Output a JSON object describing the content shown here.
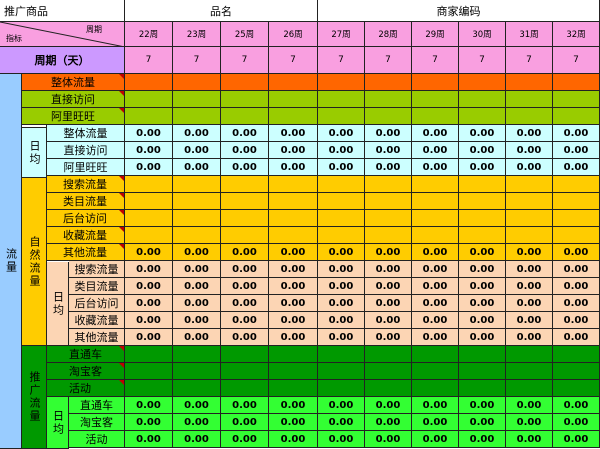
{
  "header": {
    "promo_goods": "推广商品",
    "product_name": "品名",
    "merchant_code": "商家编码",
    "diag_top": "周期",
    "diag_bottom": "指标",
    "period_days": "周期（天）"
  },
  "weeks": [
    "22周",
    "23周",
    "25周",
    "26周",
    "27周",
    "28周",
    "29周",
    "30周",
    "31周",
    "32周"
  ],
  "period_values": [
    "7",
    "7",
    "7",
    "7",
    "7",
    "7",
    "7",
    "7",
    "7",
    "7"
  ],
  "labels": {
    "traffic": "流量",
    "daily_avg": "日均",
    "natural_traffic": "自然流量",
    "promo_traffic": "推广流量",
    "overall": "整体流量",
    "direct": "直接访问",
    "wangwang": "阿里旺旺",
    "search": "搜索流量",
    "category": "类目流量",
    "backend": "后台访问",
    "favorites": "收藏流量",
    "other": "其他流量",
    "ztc": "直通车",
    "taobaoke": "淘宝客",
    "activity": "活动"
  },
  "rows": [
    {
      "label": "整体流量",
      "indent": 1,
      "bg": "#ff6600",
      "values": []
    },
    {
      "label": "直接访问",
      "indent": 1,
      "bg": "#99cc00",
      "values": []
    },
    {
      "label": "阿里旺旺",
      "indent": 1,
      "bg": "#99cc00",
      "values": []
    },
    {
      "label": "整体流量",
      "indent": 2,
      "bg": "#ccffff",
      "values": [
        "0.00",
        "0.00",
        "0.00",
        "0.00",
        "0.00",
        "0.00",
        "0.00",
        "0.00",
        "0.00",
        "0.00"
      ]
    },
    {
      "label": "直接访问",
      "indent": 2,
      "bg": "#ccffff",
      "values": [
        "0.00",
        "0.00",
        "0.00",
        "0.00",
        "0.00",
        "0.00",
        "0.00",
        "0.00",
        "0.00",
        "0.00"
      ]
    },
    {
      "label": "阿里旺旺",
      "indent": 2,
      "bg": "#ccffff",
      "values": [
        "0.00",
        "0.00",
        "0.00",
        "0.00",
        "0.00",
        "0.00",
        "0.00",
        "0.00",
        "0.00",
        "0.00"
      ]
    },
    {
      "label": "搜索流量",
      "indent": 3,
      "bg": "#ffcc00",
      "values": []
    },
    {
      "label": "类目流量",
      "indent": 3,
      "bg": "#ffcc00",
      "values": []
    },
    {
      "label": "后台访问",
      "indent": 3,
      "bg": "#ffcc00",
      "values": []
    },
    {
      "label": "收藏流量",
      "indent": 3,
      "bg": "#ffcc00",
      "values": []
    },
    {
      "label": "其他流量",
      "indent": 3,
      "bg": "#ffcc00",
      "values": [
        "0.00",
        "0.00",
        "0.00",
        "0.00",
        "0.00",
        "0.00",
        "0.00",
        "0.00",
        "0.00",
        "0.00"
      ]
    },
    {
      "label": "搜索流量",
      "indent": 4,
      "bg": "#fcd5b4",
      "values": [
        "0.00",
        "0.00",
        "0.00",
        "0.00",
        "0.00",
        "0.00",
        "0.00",
        "0.00",
        "0.00",
        "0.00"
      ]
    },
    {
      "label": "类目流量",
      "indent": 4,
      "bg": "#fcd5b4",
      "values": [
        "0.00",
        "0.00",
        "0.00",
        "0.00",
        "0.00",
        "0.00",
        "0.00",
        "0.00",
        "0.00",
        "0.00"
      ]
    },
    {
      "label": "后台访问",
      "indent": 4,
      "bg": "#fcd5b4",
      "values": [
        "0.00",
        "0.00",
        "0.00",
        "0.00",
        "0.00",
        "0.00",
        "0.00",
        "0.00",
        "0.00",
        "0.00"
      ]
    },
    {
      "label": "收藏流量",
      "indent": 4,
      "bg": "#fcd5b4",
      "values": [
        "0.00",
        "0.00",
        "0.00",
        "0.00",
        "0.00",
        "0.00",
        "0.00",
        "0.00",
        "0.00",
        "0.00"
      ]
    },
    {
      "label": "其他流量",
      "indent": 4,
      "bg": "#fcd5b4",
      "values": [
        "0.00",
        "0.00",
        "0.00",
        "0.00",
        "0.00",
        "0.00",
        "0.00",
        "0.00",
        "0.00",
        "0.00"
      ]
    },
    {
      "label": "直通车",
      "indent": 5,
      "bg": "#009900",
      "values": []
    },
    {
      "label": "淘宝客",
      "indent": 5,
      "bg": "#009900",
      "values": []
    },
    {
      "label": "活动",
      "indent": 5,
      "bg": "#009900",
      "values": []
    },
    {
      "label": "直通车",
      "indent": 6,
      "bg": "#33ff33",
      "values": [
        "0.00",
        "0.00",
        "0.00",
        "0.00",
        "0.00",
        "0.00",
        "0.00",
        "0.00",
        "0.00",
        "0.00"
      ]
    },
    {
      "label": "淘宝客",
      "indent": 6,
      "bg": "#33ff33",
      "values": [
        "0.00",
        "0.00",
        "0.00",
        "0.00",
        "0.00",
        "0.00",
        "0.00",
        "0.00",
        "0.00",
        "0.00"
      ]
    },
    {
      "label": "活动",
      "indent": 6,
      "bg": "#33ff33",
      "values": [
        "0.00",
        "0.00",
        "0.00",
        "0.00",
        "0.00",
        "0.00",
        "0.00",
        "0.00",
        "0.00",
        "0.00"
      ]
    }
  ],
  "colors": {
    "header_pink": "#f99fe0",
    "period_purple": "#cc99ff",
    "traffic_blue": "#99ccff",
    "natural_orange": "#ffcc00",
    "daily_cyan": "#ccffff",
    "promo_green": "#009900",
    "mark_red": "#c00000"
  }
}
